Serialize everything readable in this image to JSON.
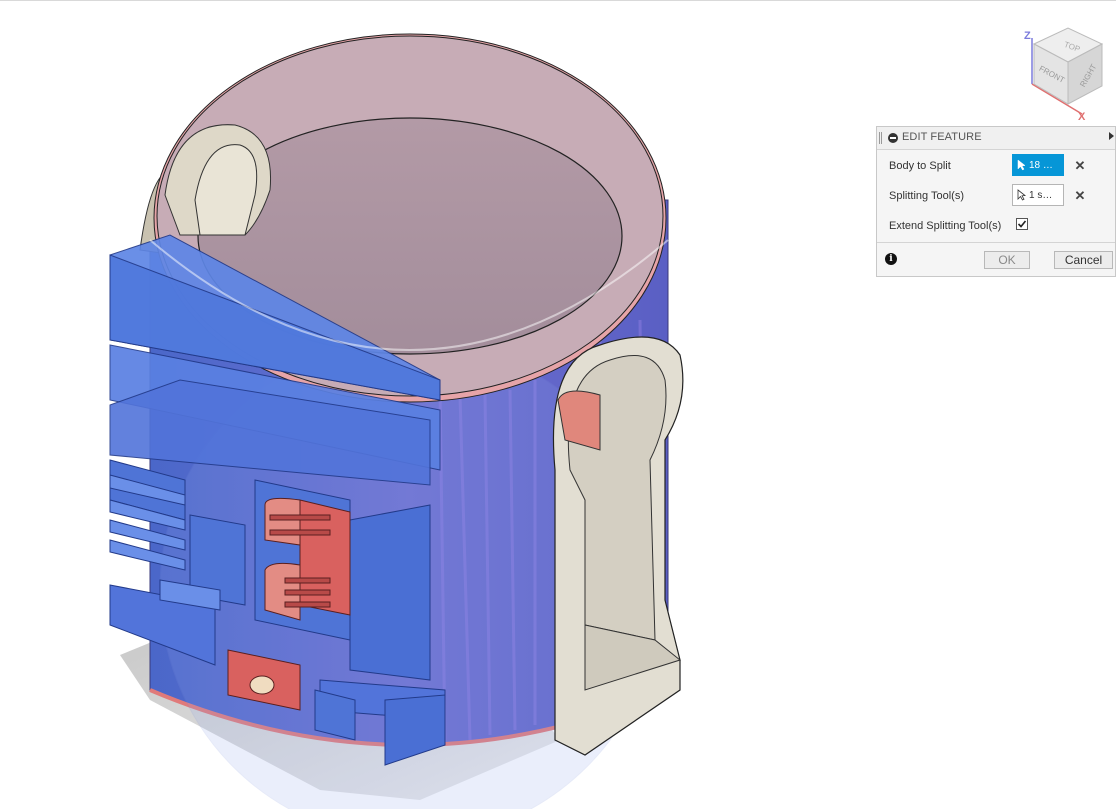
{
  "viewcube": {
    "face_top": "TOP",
    "face_front": "FRONT",
    "face_right": "RIGHT",
    "axis_z": "Z",
    "axis_x": "X"
  },
  "edit_feature": {
    "title": "EDIT FEATURE",
    "rows": [
      {
        "label": "Body to Split",
        "selection": "18 s...",
        "active": true
      },
      {
        "label": "Splitting Tool(s)",
        "selection": "1 su...",
        "active": false
      }
    ],
    "extend_label": "Extend Splitting Tool(s)",
    "extend_checked": true,
    "ok_label": "OK",
    "cancel_label": "Cancel",
    "info_glyph": "i"
  },
  "colors": {
    "body_blue": "#5b7fdb",
    "split_red": "#d9615f",
    "handle_beige": "#dedbd0",
    "rim_pink": "#c9a8ad",
    "selection_blue": "#0696d7"
  }
}
